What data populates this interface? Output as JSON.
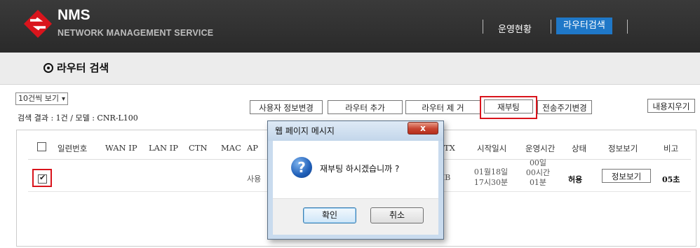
{
  "header": {
    "brand_title": "NMS",
    "brand_subtitle": "NETWORK MANAGEMENT SERVICE",
    "nav": {
      "status": "운영현황",
      "router_search": "라우터검색"
    },
    "colors": {
      "header_bg": "#2f2f2f",
      "active_nav": "#1f78c8",
      "logo_red": "#d9141c"
    }
  },
  "page": {
    "title": "라우터 검색"
  },
  "controls": {
    "page_size": "10건씩 보기",
    "result_summary": "검색 결과 : 1건 / 모델 : CNR-L100",
    "buttons": {
      "user_info": "사용자 정보변경",
      "add_router": "라우터 추가",
      "remove_router": "라우터 제 거",
      "reboot": "재부팅",
      "period_change": "전송주기변경",
      "clear": "내용지우기"
    }
  },
  "table": {
    "columns": [
      "일련번호",
      "WAN IP",
      "LAN IP",
      "CTN",
      "MAC",
      "AP",
      "",
      "",
      "",
      "",
      "",
      "",
      "",
      "",
      "",
      "",
      ""
    ],
    "columns_visible_right": [
      "TX",
      "시작일시",
      "운영시간",
      "상태",
      "정보보기",
      "비고"
    ],
    "row": {
      "checked": true,
      "apn_fragment": "사용",
      "traffic_fragment": "MB",
      "start_line1": "01월18일",
      "start_line2": "17시30분",
      "uptime_line1": "00일",
      "uptime_line2": "00시간",
      "uptime_line3": "01분",
      "status": "허용",
      "detail_button": "정보보기",
      "remark": "05초"
    }
  },
  "dialog": {
    "title": "웹 페이지 메시지",
    "close_glyph": "x",
    "message": "재부팅 하시겠습니까 ?",
    "ok": "확인",
    "cancel": "취소",
    "icon": "question-icon"
  }
}
